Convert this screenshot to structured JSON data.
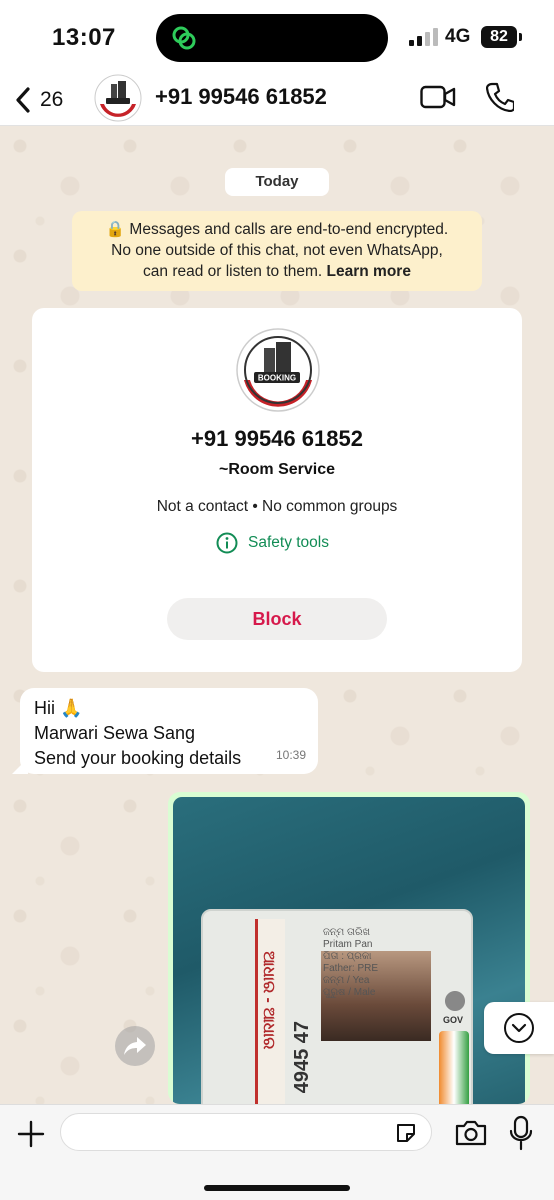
{
  "status_bar": {
    "time": "13:07",
    "network": "4G",
    "battery": "82"
  },
  "header": {
    "back_count": "26",
    "title": "+91 99546 61852"
  },
  "chat": {
    "date_chip": "Today",
    "encryption_notice": {
      "text_line1": "Messages and calls are end-to-end encrypted.",
      "text_line2": "No one outside of this chat, not even WhatsApp,",
      "text_line3": "can read or listen to them.",
      "learn_more": "Learn more"
    },
    "profile_card": {
      "avatar_label": "BOOKING",
      "number": "+91 99546 61852",
      "name": "~Room Service",
      "meta": "Not a contact • No common groups",
      "safety_tools": "Safety tools",
      "block_label": "Block"
    },
    "incoming_message": {
      "line1": "Hii 🙏",
      "line2": "Marwari Sewa Sang",
      "line3": "Send your booking details",
      "time": "10:39"
    },
    "outgoing_image": {
      "id_number": "4945 47",
      "id_script": "ଆଧାର - ଆଧାର",
      "id_lines": [
        "ଜନ୍ମ ତାରିଖ",
        "Pritam Pan",
        "ପିତା : ପ୍ରକା",
        "Father: PRE",
        "ଜନ୍ମ / Yea",
        "ପୁରୁଷ / Male"
      ],
      "emblem_text": "GOV"
    }
  },
  "input_bar": {
    "placeholder": ""
  },
  "colors": {
    "accent_green": "#128c55",
    "block_red": "#d6194b",
    "bubble_out": "#d9fdd3",
    "notice_bg": "#fdf0cc"
  }
}
